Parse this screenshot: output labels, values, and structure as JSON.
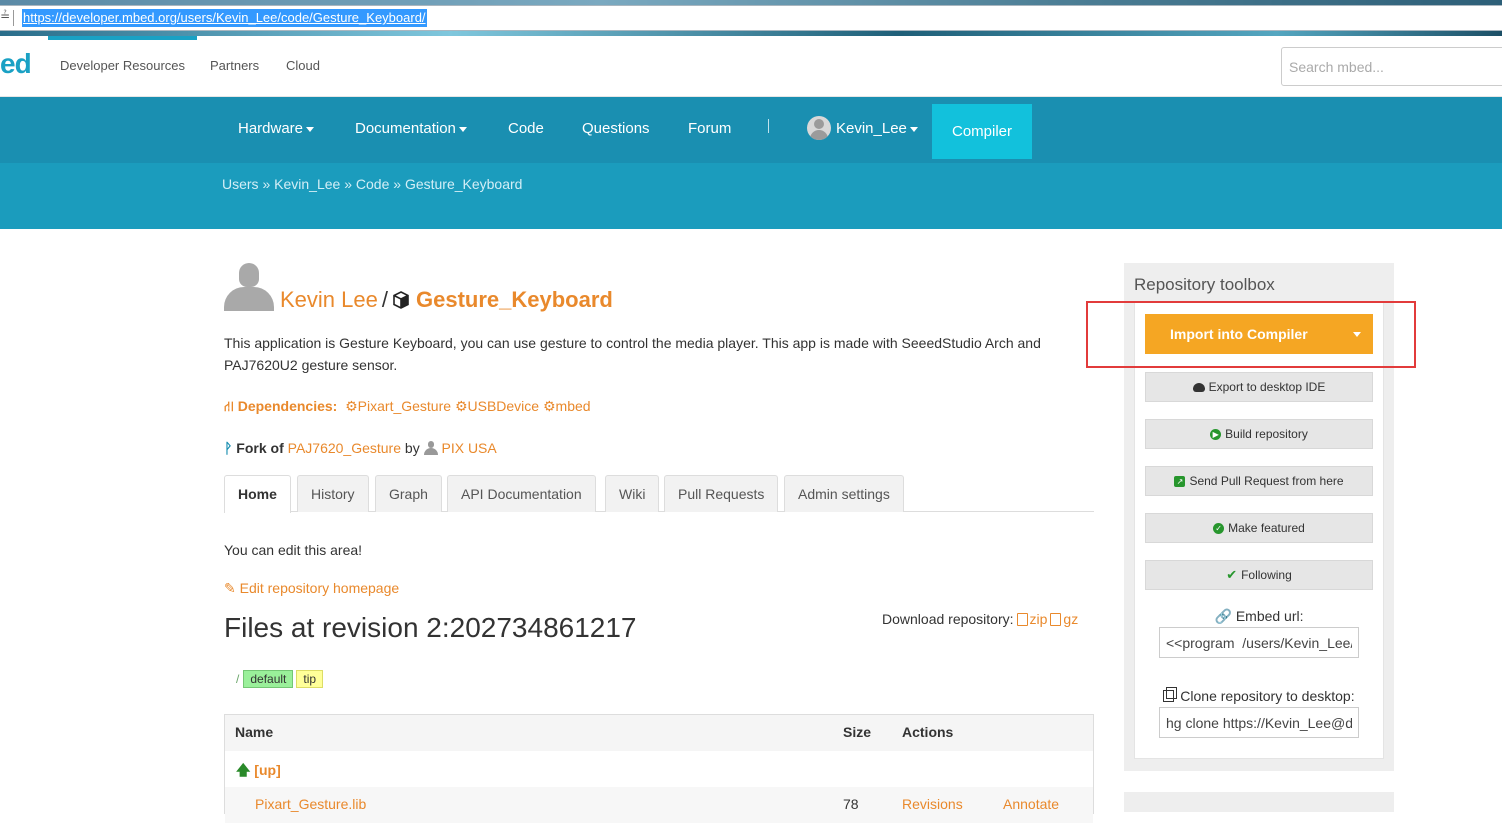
{
  "browser": {
    "url": "https://developer.mbed.org/users/Kevin_Lee/code/Gesture_Keyboard/",
    "lock_glyph": "≟"
  },
  "topnav": {
    "logo_fragment": "ed",
    "links": [
      "Developer Resources",
      "Partners",
      "Cloud"
    ],
    "search_placeholder": "Search mbed..."
  },
  "mainnav": {
    "items": [
      "Hardware",
      "Documentation",
      "Code",
      "Questions",
      "Forum"
    ],
    "user": "Kevin_Lee",
    "compiler": "Compiler"
  },
  "breadcrumb": {
    "parts": [
      "Users",
      "Kevin_Lee",
      "Code",
      "Gesture_Keyboard"
    ],
    "separator": " » "
  },
  "repo": {
    "owner": "Kevin Lee",
    "slash": "/",
    "name": "Gesture_Keyboard",
    "description": "This application is Gesture Keyboard, you can use gesture to control the media player. This app is made with SeeedStudio Arch and PAJ7620U2 gesture sensor.",
    "dependencies_label": "Dependencies:",
    "dependencies": [
      "Pixart_Gesture",
      "USBDevice",
      "mbed"
    ],
    "fork_label": "Fork of",
    "fork_of": "PAJ7620_Gesture",
    "fork_by": "by",
    "fork_owner": "PIX USA"
  },
  "tabs": [
    "Home",
    "History",
    "Graph",
    "API Documentation",
    "Wiki",
    "Pull Requests",
    "Admin settings"
  ],
  "home": {
    "edit_note": "You can edit this area!",
    "edit_link": "Edit repository homepage",
    "files_heading": "Files at revision 2:202734861217",
    "download_label": "Download repository:",
    "download_zip": "zip",
    "download_gz": "gz",
    "branch_slash": "/",
    "tag_default": "default",
    "tag_tip": "tip"
  },
  "file_table": {
    "headers": [
      "Name",
      "Size",
      "Actions"
    ],
    "up_row": "[up]",
    "row2": {
      "name": "Pixart_Gesture.lib",
      "size": "78",
      "action1": "Revisions",
      "action2": "Annotate"
    }
  },
  "toolbox": {
    "title": "Repository toolbox",
    "import": "Import into Compiler",
    "export": "Export to desktop IDE",
    "build": "Build repository",
    "pull": "Send Pull Request from here",
    "featured": "Make featured",
    "following": "Following",
    "embed_label": "Embed url:",
    "embed_value": "<<program  /users/Kevin_Lee/code/Gesture_Keyboard/>>",
    "clone_label": "Clone repository to desktop:",
    "clone_value": "hg clone https://Kevin_Lee@developer.mbed.org/users/Kevin_Lee/code/Gesture_Keyboard/"
  },
  "colors": {
    "brand_teal": "#1a8fb1",
    "compiler_cyan": "#12c1dc",
    "link_orange": "#e9892c",
    "import_orange": "#f5a623",
    "highlight_red": "#e23b3b"
  }
}
